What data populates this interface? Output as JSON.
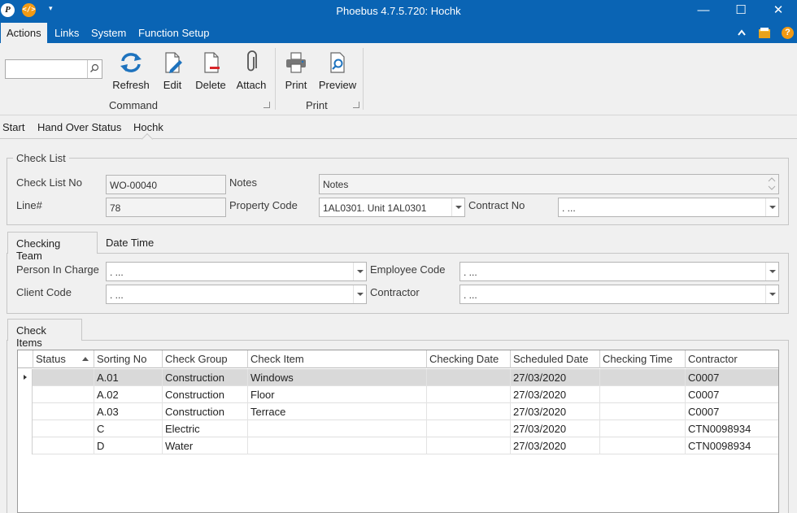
{
  "window": {
    "title": "Phoebus 4.7.5.720: Hochk",
    "logo_letter": "P",
    "code_glyph": "</>",
    "qat_glyph": "▾",
    "minimize_glyph": "—",
    "maximize_glyph": "☐",
    "close_glyph": "✕",
    "accent": "#0a64b4"
  },
  "menu": {
    "items": [
      {
        "label": "Actions"
      },
      {
        "label": "Links"
      },
      {
        "label": "System"
      },
      {
        "label": "Function Setup"
      }
    ],
    "right_icons": [
      "chevron-up-icon",
      "folder-icon",
      "help-icon"
    ],
    "help_glyph": "?"
  },
  "ribbon": {
    "search": {
      "value": "",
      "placeholder": ""
    },
    "groups": [
      {
        "label": "Command",
        "buttons": [
          {
            "label": "Refresh",
            "icon": "refresh-icon"
          },
          {
            "label": "Edit",
            "icon": "edit-icon"
          },
          {
            "label": "Delete",
            "icon": "delete-icon"
          },
          {
            "label": "Attach",
            "icon": "paperclip-icon"
          }
        ]
      },
      {
        "label": "Print",
        "buttons": [
          {
            "label": "Print",
            "icon": "printer-icon"
          },
          {
            "label": "Preview",
            "icon": "preview-icon"
          }
        ]
      }
    ]
  },
  "breadcrumb": {
    "items": [
      {
        "label": "Start"
      },
      {
        "label": "Hand Over Status"
      },
      {
        "label": "Hochk"
      }
    ]
  },
  "check_list": {
    "title": "Check List",
    "check_list_no": {
      "label": "Check List No",
      "value": "WO-00040"
    },
    "line_no": {
      "label": "Line#",
      "value": "78"
    },
    "notes": {
      "label": "Notes",
      "value": "Notes"
    },
    "property_code": {
      "label": "Property Code",
      "value": "1AL0301. Unit 1AL0301"
    },
    "contract_no": {
      "label": "Contract No",
      "value": ". ..."
    }
  },
  "team_tabs": {
    "tabs": [
      {
        "label": "Checking Team"
      },
      {
        "label": "Date Time"
      }
    ],
    "person_in_charge": {
      "label": "Person In Charge",
      "value": ". ..."
    },
    "client_code": {
      "label": "Client Code",
      "value": ". ..."
    },
    "employee_code": {
      "label": "Employee Code",
      "value": ". ..."
    },
    "contractor": {
      "label": "Contractor",
      "value": ". ..."
    }
  },
  "check_items": {
    "tab_label": "Check Items",
    "columns": [
      "Status",
      "Sorting No",
      "Check Group",
      "Check Item",
      "Checking Date",
      "Scheduled Date",
      "Checking Time",
      "Contractor"
    ],
    "rows": [
      {
        "status": "",
        "sorting_no": "A.01",
        "check_group": "Construction",
        "check_item": "Windows",
        "checking_date": "",
        "scheduled_date": "27/03/2020",
        "checking_time": "",
        "contractor": "C0007"
      },
      {
        "status": "",
        "sorting_no": "A.02",
        "check_group": "Construction",
        "check_item": "Floor",
        "checking_date": "",
        "scheduled_date": "27/03/2020",
        "checking_time": "",
        "contractor": "C0007"
      },
      {
        "status": "",
        "sorting_no": "A.03",
        "check_group": "Construction",
        "check_item": "Terrace",
        "checking_date": "",
        "scheduled_date": "27/03/2020",
        "checking_time": "",
        "contractor": "C0007"
      },
      {
        "status": "",
        "sorting_no": "C",
        "check_group": "Electric",
        "check_item": "",
        "checking_date": "",
        "scheduled_date": "27/03/2020",
        "checking_time": "",
        "contractor": "CTN0098934"
      },
      {
        "status": "",
        "sorting_no": "D",
        "check_group": "Water",
        "check_item": "",
        "checking_date": "",
        "scheduled_date": "27/03/2020",
        "checking_time": "",
        "contractor": "CTN0098934"
      }
    ]
  }
}
